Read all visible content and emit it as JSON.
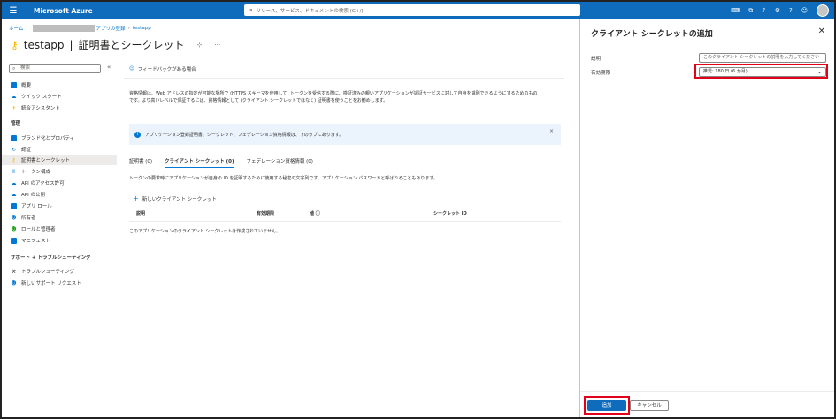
{
  "header": {
    "brand": "Microsoft Azure",
    "search_placeholder": "リソース、サービス、ドキュメントの検索 (G+/)",
    "icons": [
      "cloud-shell-icon",
      "directory-icon",
      "bell-icon",
      "gear-icon",
      "help-icon",
      "feedback-icon"
    ]
  },
  "breadcrumb": {
    "home": "ホーム",
    "app_reg": "アプリの登録",
    "app": "testapp"
  },
  "title": {
    "app": "testapp",
    "sep": "|",
    "page": "証明書とシークレット",
    "pin": "⊹",
    "more": "···"
  },
  "sidebar": {
    "search_placeholder": "検索",
    "collapse": "«",
    "items_top": [
      {
        "label": "概要",
        "color": "#0078d4"
      },
      {
        "label": "クイック スタート",
        "color": "#0078d4"
      },
      {
        "label": "統合アシスタント",
        "color": "#ffb900"
      }
    ],
    "manage_heading": "管理",
    "items_manage": [
      {
        "label": "ブランド化とプロパティ",
        "color": "#0078d4"
      },
      {
        "label": "認証",
        "color": "#0078d4"
      },
      {
        "label": "証明書とシークレット",
        "color": "#f7b800"
      },
      {
        "label": "トークン構成",
        "color": "#0078d4"
      },
      {
        "label": "API のアクセス許可",
        "color": "#0078d4"
      },
      {
        "label": "API の公開",
        "color": "#0078d4"
      },
      {
        "label": "アプリ ロール",
        "color": "#0078d4"
      },
      {
        "label": "所有者",
        "color": "#0078d4"
      },
      {
        "label": "ロールと管理者",
        "color": "#13a10e"
      },
      {
        "label": "マニフェスト",
        "color": "#0078d4"
      }
    ],
    "support_heading": "サポート + トラブルシューティング",
    "items_support": [
      {
        "label": "トラブルシューティング",
        "color": "#323130"
      },
      {
        "label": "新しいサポート リクエスト",
        "color": "#0078d4"
      }
    ]
  },
  "main": {
    "feedback": "フィードバックがある場合",
    "description_line1": "資格情報は、Web アドレスの指定が可能な場所で (HTTPS スキーマを使用して) トークンを受信する際に、検証済みの親いアプリケーションが認証サービスに対して自身を識別できるようにするためのもの",
    "description_line2": "です。より高いレベルで保証するには、資格情報として (クライアント シークレットではなく) 証明書を使うことをお勧めします。",
    "info_text": "アプリケーション登録証明書、シークレット、フェデレーション資格情報は、下のタブにあります。",
    "info_close": "×",
    "tabs": [
      {
        "label": "証明書 (0)"
      },
      {
        "label": "クライアント シークレット (0)"
      },
      {
        "label": "フェデレーション資格情報 (0)"
      }
    ],
    "tab_description": "トークンの要求時にアプリケーションが自身の ID を証明するために使用する秘密の文字列です。アプリケーション パスワードと呼ばれることもあります。",
    "new_secret": "新しいクライアント シークレット",
    "columns": [
      "説明",
      "有効期限",
      "値 ⓘ",
      "シークレット ID"
    ],
    "empty": "このアプリケーションのクライアント シークレットは作成されていません。"
  },
  "panel": {
    "title": "クライアント シークレットの追加",
    "close": "✕",
    "desc_label": "説明",
    "desc_placeholder": "このクライアント シークレットの説明を入力してください",
    "expires_label": "有効期限",
    "expires_value": "推奨: 180 日 (6 か月)",
    "add_button": "追加",
    "cancel_button": "キャンセル"
  },
  "colors": {
    "accent": "#0f6cbd",
    "highlight": "#e3001b"
  }
}
